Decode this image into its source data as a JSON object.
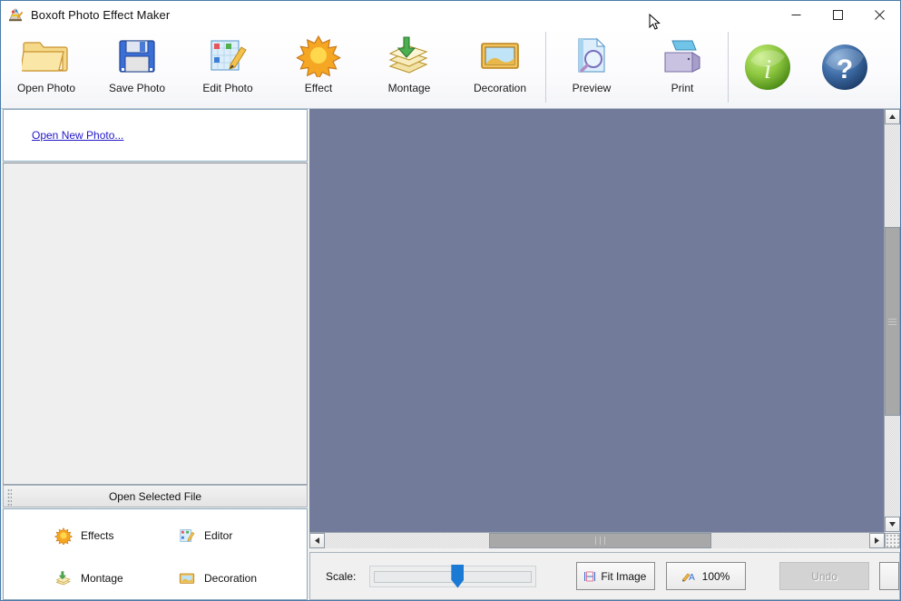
{
  "window": {
    "title": "Boxoft Photo Effect Maker",
    "app_icon": "palette-icon",
    "minimize_label": "—",
    "maximize_label": "□",
    "close_label": "✕"
  },
  "toolbar": {
    "buttons": [
      {
        "label": "Open Photo",
        "icon": "open-folder-photo-icon"
      },
      {
        "label": "Save Photo",
        "icon": "floppy-disk-icon"
      },
      {
        "label": "Edit Photo",
        "icon": "grid-pencil-icon"
      },
      {
        "label": "Effect",
        "icon": "sun-icon"
      },
      {
        "label": "Montage",
        "icon": "layers-down-arrow-icon"
      },
      {
        "label": "Decoration",
        "icon": "framed-picture-icon"
      },
      {
        "label": "Preview",
        "icon": "document-magnifier-icon"
      },
      {
        "label": "Print",
        "icon": "printer-icon"
      }
    ],
    "orbs": [
      {
        "name": "info-orb-icon",
        "glyph": "i",
        "color": "#7ac142"
      },
      {
        "name": "help-orb-icon",
        "glyph": "?",
        "color": "#2f5d96"
      }
    ]
  },
  "sidebar": {
    "open_new_photo": "Open New Photo...",
    "open_selected_file": "Open Selected File",
    "shortcuts": [
      {
        "label": "Effects",
        "icon": "sun-icon"
      },
      {
        "label": "Editor",
        "icon": "grid-pencil-icon"
      },
      {
        "label": "Montage",
        "icon": "layers-down-arrow-icon"
      },
      {
        "label": "Decoration",
        "icon": "framed-picture-icon"
      }
    ]
  },
  "canvas": {
    "background_color": "#737b9b"
  },
  "bottom_bar": {
    "scale_label": "Scale:",
    "fit_image_label": "Fit Image",
    "zoom_100_label": "100%",
    "undo_label": "Undo"
  }
}
